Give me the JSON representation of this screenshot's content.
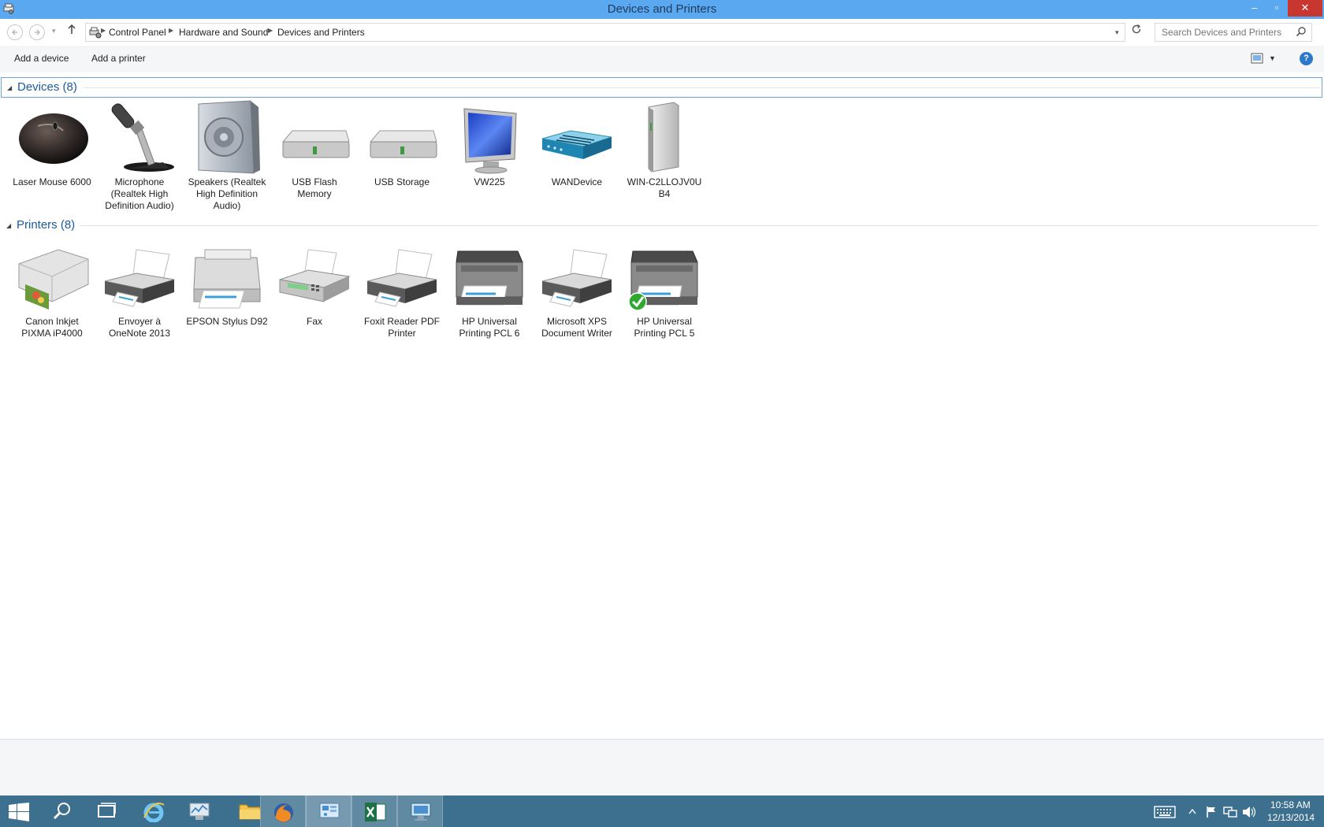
{
  "window": {
    "title": "Devices and Printers",
    "controls": {
      "minimize": "–",
      "maximize": "▫",
      "close": "✕"
    }
  },
  "address": {
    "breadcrumbs": [
      "Control Panel",
      "Hardware and Sound",
      "Devices and Printers"
    ],
    "search_placeholder": "Search Devices and Printers"
  },
  "commands": {
    "add_device": "Add a device",
    "add_printer": "Add a printer",
    "help": "?"
  },
  "groups": {
    "devices": {
      "title": "Devices (8)",
      "items": [
        {
          "label": "Laser Mouse 6000",
          "icon": "mouse-icon"
        },
        {
          "label": "Microphone (Realtek High Definition Audio)",
          "icon": "microphone-icon"
        },
        {
          "label": "Speakers (Realtek High Definition Audio)",
          "icon": "speaker-icon"
        },
        {
          "label": "USB Flash Memory",
          "icon": "drive-icon"
        },
        {
          "label": "USB Storage",
          "icon": "drive-icon"
        },
        {
          "label": "VW225",
          "icon": "monitor-icon"
        },
        {
          "label": "WANDevice",
          "icon": "router-icon"
        },
        {
          "label": "WIN-C2LLOJV0U B4",
          "icon": "computer-tower-icon"
        }
      ]
    },
    "printers": {
      "title": "Printers (8)",
      "items": [
        {
          "label": "Canon Inkjet PIXMA iP4000",
          "icon": "photo-printer-icon"
        },
        {
          "label": "Envoyer à OneNote 2013",
          "icon": "printer-icon"
        },
        {
          "label": "EPSON Stylus D92",
          "icon": "printer-icon"
        },
        {
          "label": "Fax",
          "icon": "fax-icon"
        },
        {
          "label": "Foxit Reader PDF Printer",
          "icon": "printer-icon"
        },
        {
          "label": "HP Universal Printing PCL 6",
          "icon": "multifunction-printer-icon"
        },
        {
          "label": "Microsoft XPS Document Writer",
          "icon": "printer-icon"
        },
        {
          "label": "HP Universal Printing PCL 5",
          "icon": "multifunction-printer-icon",
          "default": true
        }
      ]
    }
  },
  "taskbar": {
    "apps": [
      "start-icon",
      "search-icon",
      "task-view-icon",
      "internet-explorer-icon",
      "performance-monitor-icon",
      "file-explorer-icon",
      "firefox-icon",
      "control-panel-icon",
      "excel-icon",
      "remote-desktop-icon"
    ],
    "active_app": "control-panel-icon",
    "clock_time": "10:58 AM",
    "clock_date": "12/13/2014"
  },
  "colors": {
    "titlebar": "#5aa8ef",
    "close_button": "#c7372f",
    "group_title": "#1e5aa0",
    "taskbar": "#3d6f8e",
    "default_check": "#2fa82f"
  }
}
